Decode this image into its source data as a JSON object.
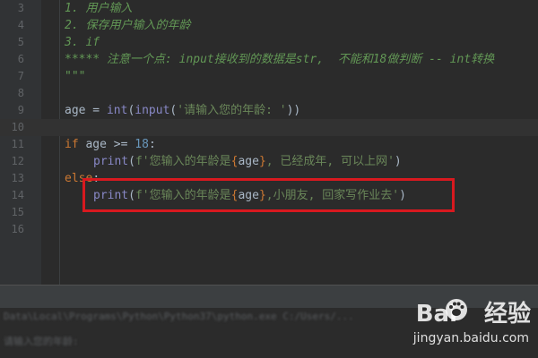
{
  "editor": {
    "lines": [
      {
        "num": "3",
        "parts": [
          {
            "t": "1. 用户输入",
            "c": "c-doc"
          }
        ]
      },
      {
        "num": "4",
        "parts": [
          {
            "t": "2. 保存用户输入的年龄",
            "c": "c-doc"
          }
        ]
      },
      {
        "num": "5",
        "parts": [
          {
            "t": "3. if",
            "c": "c-doc"
          }
        ]
      },
      {
        "num": "6",
        "parts": [
          {
            "t": "***** 注意一个点: input接收到的数据是str,  不能和18做判断 -- int转换",
            "c": "c-doc"
          }
        ]
      },
      {
        "num": "7",
        "parts": [
          {
            "t": "\"\"\"",
            "c": "c-doc"
          }
        ]
      },
      {
        "num": "8",
        "parts": []
      },
      {
        "num": "9",
        "parts": [
          {
            "t": "age = ",
            "c": "c-var"
          },
          {
            "t": "int",
            "c": "c-fn"
          },
          {
            "t": "(",
            "c": "c-var"
          },
          {
            "t": "input",
            "c": "c-fn"
          },
          {
            "t": "(",
            "c": "c-var"
          },
          {
            "t": "'请输入您的年龄: '",
            "c": "c-str"
          },
          {
            "t": "))",
            "c": "c-var"
          }
        ]
      },
      {
        "num": "10",
        "parts": [],
        "active": true
      },
      {
        "num": "11",
        "parts": [
          {
            "t": "if ",
            "c": "c-kw"
          },
          {
            "t": "age >= ",
            "c": "c-var"
          },
          {
            "t": "18",
            "c": "c-num"
          },
          {
            "t": ":",
            "c": "c-var"
          }
        ]
      },
      {
        "num": "12",
        "indent": true,
        "parts": [
          {
            "t": "print",
            "c": "c-fn"
          },
          {
            "t": "(",
            "c": "c-var"
          },
          {
            "t": "f'您输入的年龄是",
            "c": "c-str"
          },
          {
            "t": "{",
            "c": "c-brace"
          },
          {
            "t": "age",
            "c": "c-var"
          },
          {
            "t": "}",
            "c": "c-brace"
          },
          {
            "t": ", 已经成年, 可以上网'",
            "c": "c-str"
          },
          {
            "t": ")",
            "c": "c-var"
          }
        ]
      },
      {
        "num": "13",
        "parts": [
          {
            "t": "else",
            "c": "c-kw"
          },
          {
            "t": ":",
            "c": "c-var"
          }
        ]
      },
      {
        "num": "14",
        "indent": true,
        "parts": [
          {
            "t": "print",
            "c": "c-fn"
          },
          {
            "t": "(",
            "c": "c-var"
          },
          {
            "t": "f'您输入的年龄是",
            "c": "c-str"
          },
          {
            "t": "{",
            "c": "c-brace"
          },
          {
            "t": "age",
            "c": "c-var"
          },
          {
            "t": "}",
            "c": "c-brace"
          },
          {
            "t": ",小朋友, 回家写作业去'",
            "c": "c-str"
          },
          {
            "t": ")",
            "c": "c-var"
          }
        ]
      },
      {
        "num": "15",
        "parts": []
      },
      {
        "num": "16",
        "parts": []
      }
    ]
  },
  "console": {
    "line1": "Data\\Local\\Programs\\Python\\Python37\\python.exe C:/Users/...",
    "line2": "请输入您的年龄: "
  },
  "watermark": {
    "brand_left": "Bai",
    "brand_right": "经验",
    "url": "jingyan.baidu.com"
  },
  "colors": {
    "highlight_box": "#d8191f",
    "background": "#2b2b2b"
  }
}
